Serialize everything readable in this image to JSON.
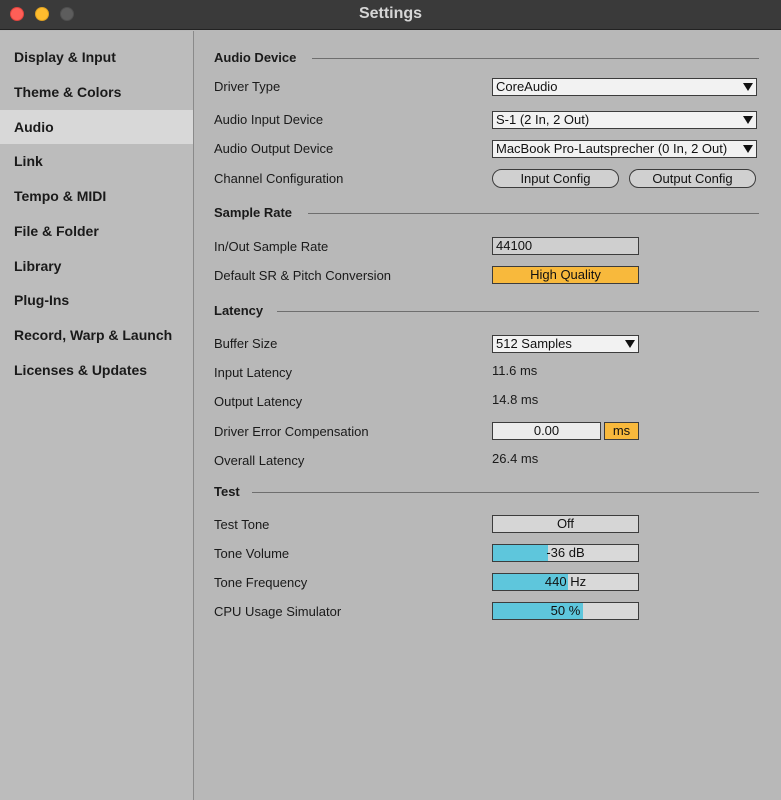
{
  "window": {
    "title": "Settings"
  },
  "sidebar": {
    "items": [
      {
        "label": "Display & Input"
      },
      {
        "label": "Theme & Colors"
      },
      {
        "label": "Audio",
        "active": true
      },
      {
        "label": "Link"
      },
      {
        "label": "Tempo & MIDI"
      },
      {
        "label": "File & Folder"
      },
      {
        "label": "Library"
      },
      {
        "label": "Plug-Ins"
      },
      {
        "label": "Record, Warp & Launch"
      },
      {
        "label": "Licenses & Updates"
      }
    ]
  },
  "audio_device": {
    "header": "Audio Device",
    "driver_type": {
      "label": "Driver Type",
      "value": "CoreAudio"
    },
    "input_device": {
      "label": "Audio Input Device",
      "value": "S-1 (2 In, 2 Out)"
    },
    "output_device": {
      "label": "Audio Output Device",
      "value": "MacBook Pro-Lautsprecher (0 In, 2 Out)"
    },
    "channel_config": {
      "label": "Channel Configuration",
      "input_button": "Input Config",
      "output_button": "Output Config"
    }
  },
  "sample_rate": {
    "header": "Sample Rate",
    "in_out": {
      "label": "In/Out Sample Rate",
      "value": "44100"
    },
    "default_sr": {
      "label": "Default SR & Pitch Conversion",
      "value": "High Quality"
    }
  },
  "latency": {
    "header": "Latency",
    "buffer_size": {
      "label": "Buffer Size",
      "value": "512 Samples"
    },
    "input_latency": {
      "label": "Input Latency",
      "value": "11.6 ms"
    },
    "output_latency": {
      "label": "Output Latency",
      "value": "14.8 ms"
    },
    "driver_error": {
      "label": "Driver Error Compensation",
      "value": "0.00",
      "unit": "ms"
    },
    "overall_latency": {
      "label": "Overall Latency",
      "value": "26.4 ms"
    }
  },
  "test": {
    "header": "Test",
    "test_tone": {
      "label": "Test Tone",
      "value": "Off"
    },
    "tone_volume": {
      "label": "Tone Volume",
      "value": "-36 dB",
      "fill_fraction": 0.38
    },
    "tone_frequency": {
      "label": "Tone Frequency",
      "value": "440 Hz",
      "fill_fraction": 0.52
    },
    "cpu_simulator": {
      "label": "CPU Usage Simulator",
      "value": "50 %",
      "fill_fraction": 0.62
    }
  },
  "colors": {
    "title_bar": "#3a3a3a",
    "close": "#fe5f57",
    "minimize": "#febc2e",
    "accent_yellow": "#f8b93c",
    "slider_fill": "#5ec6dc"
  }
}
